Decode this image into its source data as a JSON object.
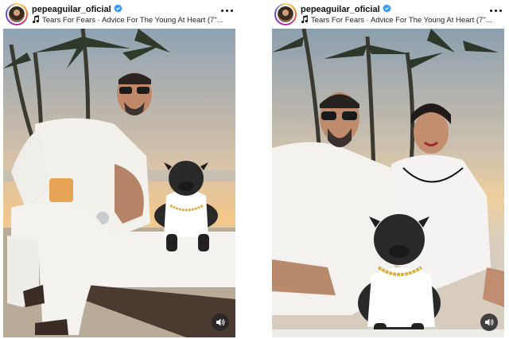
{
  "posts": [
    {
      "username": "pepeaguilar_oficial",
      "verified": true,
      "audio": "Tears For Fears · Advice For The Young At Heart (7\"...",
      "icons": {
        "audio": "music-note-icon",
        "menu": "more-options-icon",
        "sound": "speaker-icon"
      }
    },
    {
      "username": "pepeaguilar_oficial",
      "verified": true,
      "audio": "Tears For Fears · Advice For The Young At Heart (7\"...",
      "icons": {
        "audio": "music-note-icon",
        "menu": "more-options-icon",
        "sound": "speaker-icon"
      }
    }
  ],
  "colors": {
    "verified_badge": "#3897f0",
    "text": "#111111",
    "background": "#ffffff"
  }
}
